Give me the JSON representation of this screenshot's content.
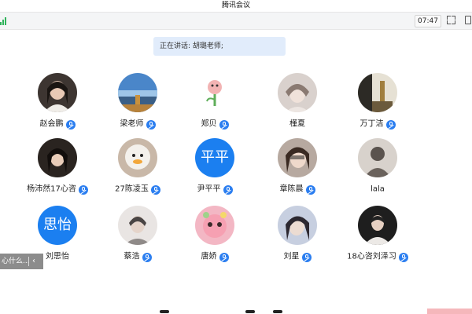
{
  "app": {
    "title": "腾讯会议"
  },
  "toolbar": {
    "time": "07:47"
  },
  "speaking": {
    "text": "正在讲话: 胡璐老师;"
  },
  "participants": [
    {
      "name": "赵会鹏",
      "mic": true
    },
    {
      "name": "梁老师",
      "mic": true
    },
    {
      "name": "郑贝",
      "mic": true
    },
    {
      "name": "槿夏",
      "mic": false
    },
    {
      "name": "万丁洁",
      "mic": true
    },
    {
      "name": "杨沛然17心咨",
      "mic": true
    },
    {
      "name": "27陈凌玉",
      "mic": true
    },
    {
      "name": "尹平平",
      "mic": true,
      "initials": "平平"
    },
    {
      "name": "章陈晨",
      "mic": true
    },
    {
      "name": "lala",
      "mic": false
    },
    {
      "name": "刘思怡",
      "mic": false,
      "initials": "思怡"
    },
    {
      "name": "蔡浩",
      "mic": true
    },
    {
      "name": "唐娇",
      "mic": true
    },
    {
      "name": "刘星",
      "mic": true
    },
    {
      "name": "18心咨刘泽习",
      "mic": true
    }
  ],
  "side_tip": {
    "text": "心什么...",
    "chevron": "‹"
  },
  "colors": {
    "accent": "#1b7ff0",
    "banner": "#e1ecfb",
    "signal": "#2fb35a"
  }
}
